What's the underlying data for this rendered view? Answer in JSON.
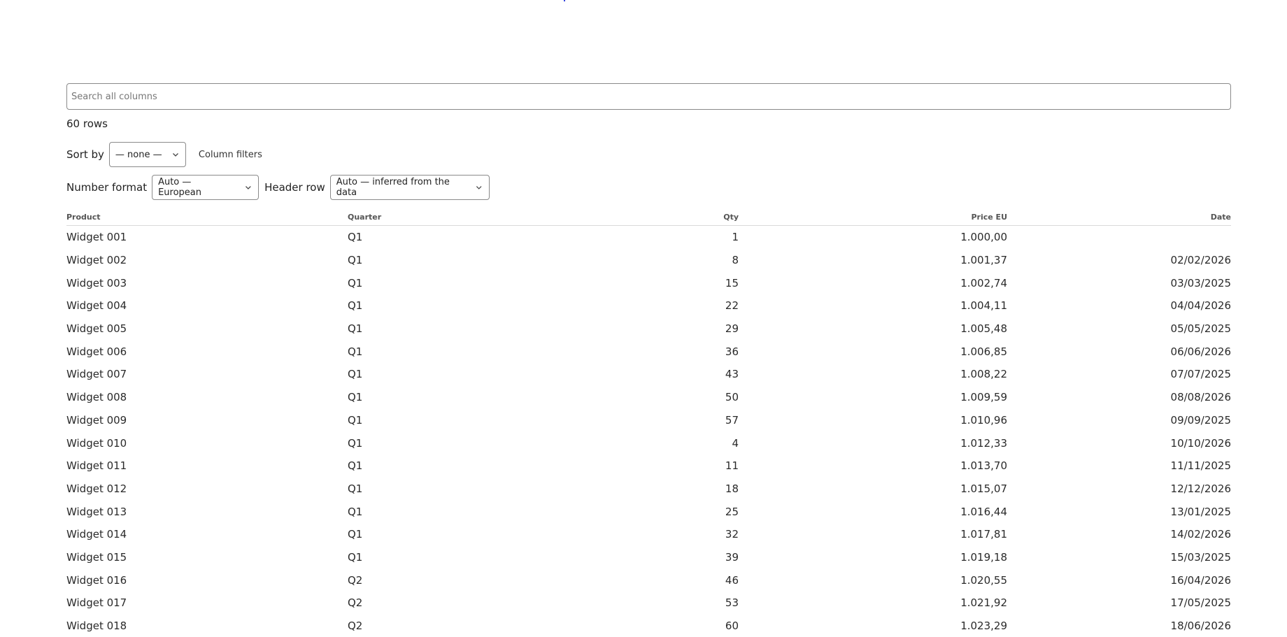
{
  "search": {
    "placeholder": "Search all columns"
  },
  "row_count": "60 rows",
  "sort": {
    "label": "Sort by",
    "value": "— none —"
  },
  "column_filters_label": "Column filters",
  "number_format": {
    "label": "Number format",
    "value": "Auto — European"
  },
  "header_row": {
    "label": "Header row",
    "value": "Auto — inferred from the data"
  },
  "table": {
    "headers": [
      "Product",
      "Quarter",
      "Qty",
      "Price EU",
      "Date"
    ],
    "rows": [
      [
        "Widget 001",
        "Q1",
        "1",
        "1.000,00",
        ""
      ],
      [
        "Widget 002",
        "Q1",
        "8",
        "1.001,37",
        "02/02/2026"
      ],
      [
        "Widget 003",
        "Q1",
        "15",
        "1.002,74",
        "03/03/2025"
      ],
      [
        "Widget 004",
        "Q1",
        "22",
        "1.004,11",
        "04/04/2026"
      ],
      [
        "Widget 005",
        "Q1",
        "29",
        "1.005,48",
        "05/05/2025"
      ],
      [
        "Widget 006",
        "Q1",
        "36",
        "1.006,85",
        "06/06/2026"
      ],
      [
        "Widget 007",
        "Q1",
        "43",
        "1.008,22",
        "07/07/2025"
      ],
      [
        "Widget 008",
        "Q1",
        "50",
        "1.009,59",
        "08/08/2026"
      ],
      [
        "Widget 009",
        "Q1",
        "57",
        "1.010,96",
        "09/09/2025"
      ],
      [
        "Widget 010",
        "Q1",
        "4",
        "1.012,33",
        "10/10/2026"
      ],
      [
        "Widget 011",
        "Q1",
        "11",
        "1.013,70",
        "11/11/2025"
      ],
      [
        "Widget 012",
        "Q1",
        "18",
        "1.015,07",
        "12/12/2026"
      ],
      [
        "Widget 013",
        "Q1",
        "25",
        "1.016,44",
        "13/01/2025"
      ],
      [
        "Widget 014",
        "Q1",
        "32",
        "1.017,81",
        "14/02/2026"
      ],
      [
        "Widget 015",
        "Q1",
        "39",
        "1.019,18",
        "15/03/2025"
      ],
      [
        "Widget 016",
        "Q2",
        "46",
        "1.020,55",
        "16/04/2026"
      ],
      [
        "Widget 017",
        "Q2",
        "53",
        "1.021,92",
        "17/05/2025"
      ],
      [
        "Widget 018",
        "Q2",
        "60",
        "1.023,29",
        "18/06/2026"
      ]
    ]
  }
}
